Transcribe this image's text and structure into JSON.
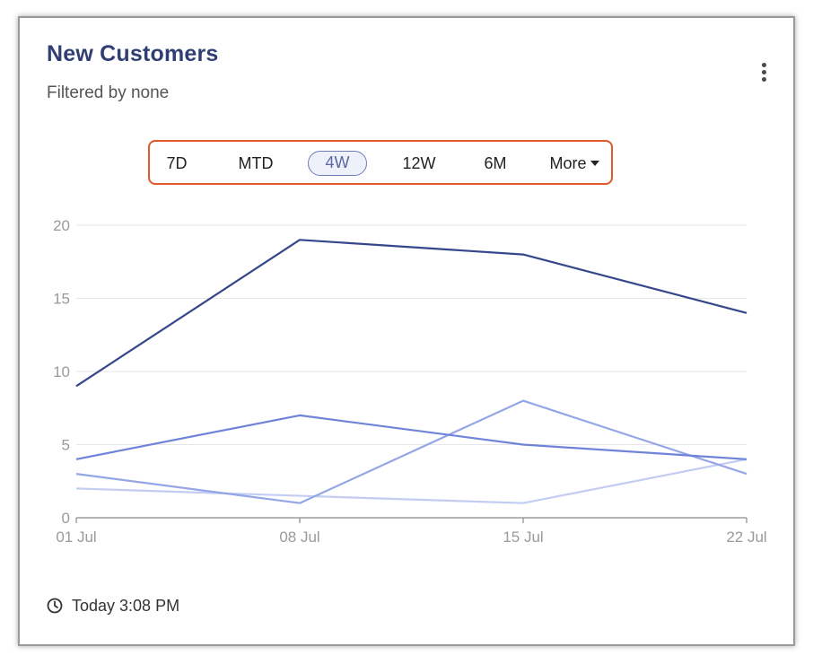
{
  "card": {
    "title": "New Customers",
    "subtitle": "Filtered by none",
    "menu_icon": "kebab-vertical-icon",
    "timestamp": "Today 3:08 PM",
    "timestamp_icon": "clock-icon"
  },
  "range_selector": {
    "options": [
      {
        "label": "7D",
        "active": false
      },
      {
        "label": "MTD",
        "active": false
      },
      {
        "label": "4W",
        "active": true
      },
      {
        "label": "12W",
        "active": false
      },
      {
        "label": "6M",
        "active": false
      },
      {
        "label": "More",
        "active": false,
        "has_dropdown": true
      }
    ],
    "highlight_color": "#e0582b"
  },
  "chart_data": {
    "type": "line",
    "title": "",
    "xlabel": "",
    "ylabel": "",
    "categories": [
      "01 Jul",
      "08 Jul",
      "15 Jul",
      "22 Jul"
    ],
    "y_ticks": [
      "0",
      "5",
      "10",
      "15",
      "20"
    ],
    "ylim": [
      0,
      20
    ],
    "grid": true,
    "legend": "none",
    "series": [
      {
        "values": [
          9,
          19,
          18,
          14
        ],
        "color": "#34478a"
      },
      {
        "values": [
          4,
          7,
          5,
          4
        ],
        "color": "#6f84d9"
      },
      {
        "values": [
          3,
          1,
          8,
          3
        ],
        "color": "#95a6e6"
      },
      {
        "values": [
          2,
          1.5,
          1,
          4
        ],
        "color": "#c3cdf2"
      }
    ]
  }
}
